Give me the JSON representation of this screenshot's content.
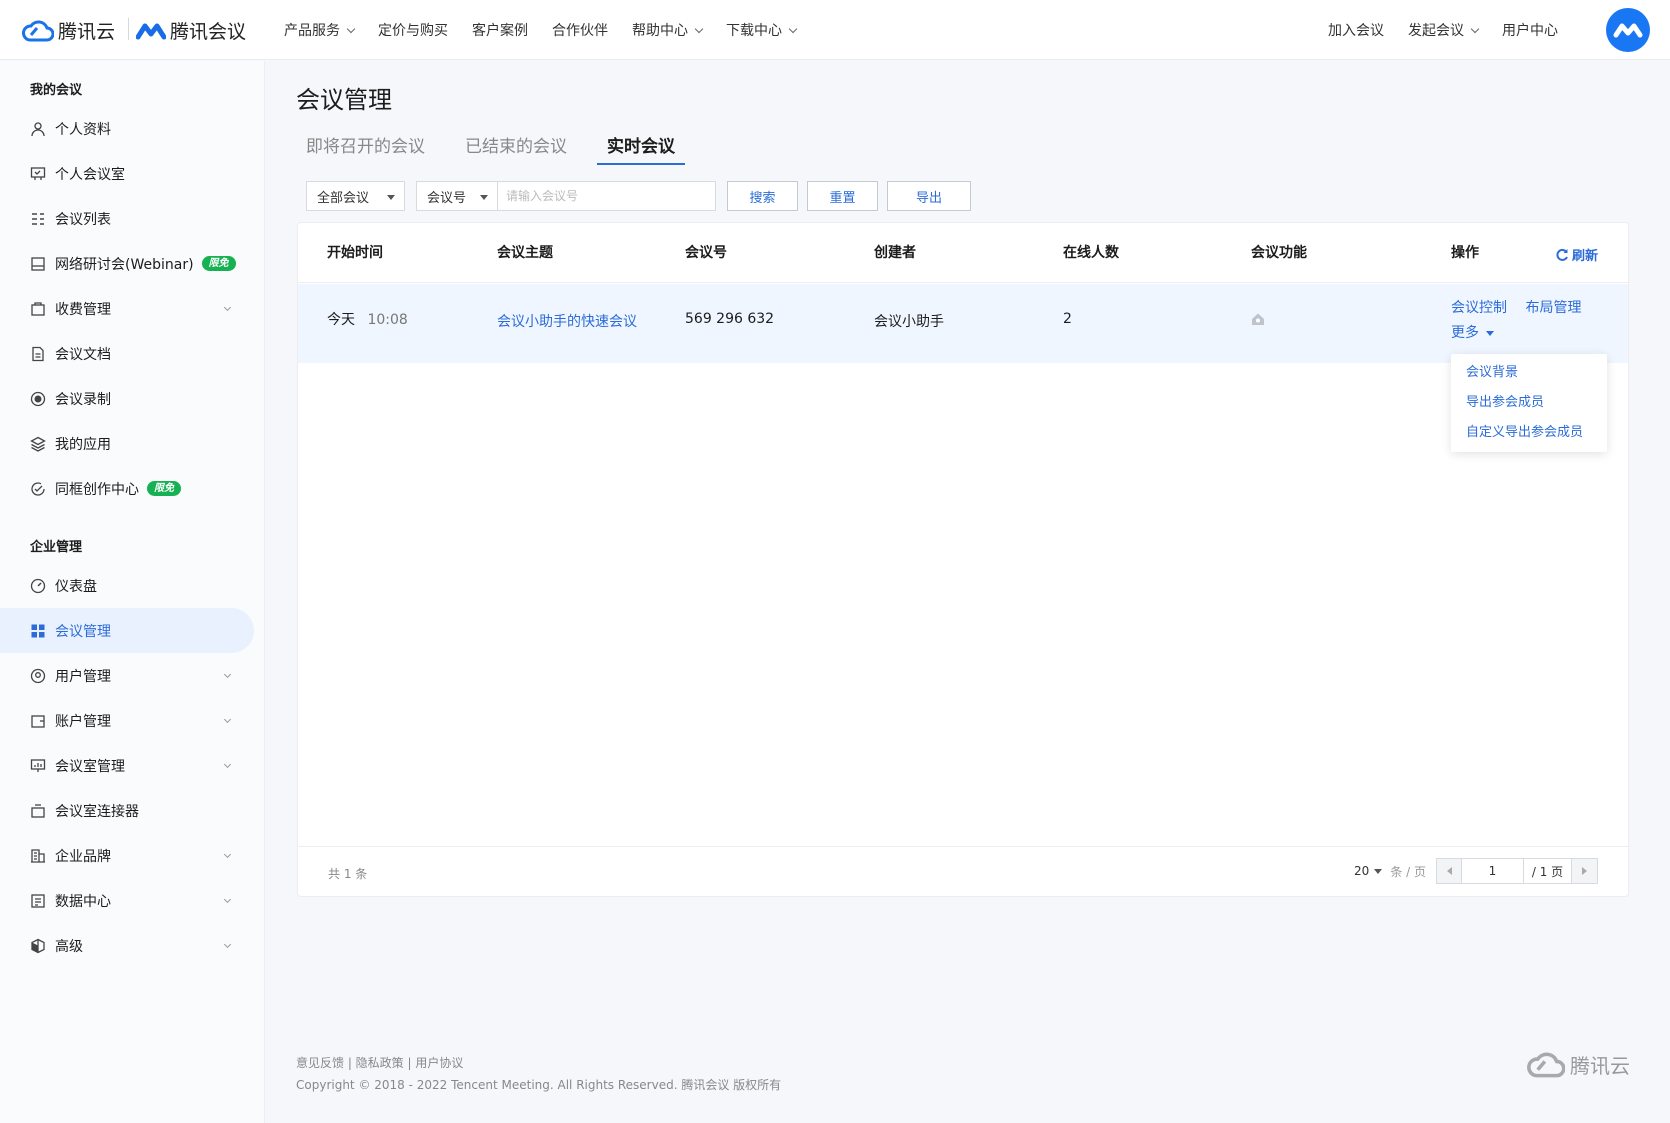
{
  "brand": {
    "tencent_cloud": "腾讯云",
    "meeting": "腾讯会议"
  },
  "nav": {
    "items": [
      {
        "label": "产品服务",
        "dropdown": true
      },
      {
        "label": "定价与购买",
        "dropdown": false
      },
      {
        "label": "客户案例",
        "dropdown": false
      },
      {
        "label": "合作伙伴",
        "dropdown": false
      },
      {
        "label": "帮助中心",
        "dropdown": true
      },
      {
        "label": "下载中心",
        "dropdown": true
      }
    ],
    "right": {
      "join": "加入会议",
      "start": "发起会议",
      "user_center": "用户中心"
    }
  },
  "sidebar": {
    "group1": "我的会议",
    "group1_items": [
      {
        "label": "个人资料",
        "icon": "user-icon"
      },
      {
        "label": "个人会议室",
        "icon": "meeting-room-icon"
      },
      {
        "label": "会议列表",
        "icon": "list-icon"
      },
      {
        "label": "网络研讨会(Webinar)",
        "icon": "webinar-icon",
        "badge": "限免"
      },
      {
        "label": "收费管理",
        "icon": "billing-icon",
        "arrow": true
      },
      {
        "label": "会议文档",
        "icon": "document-icon"
      },
      {
        "label": "会议录制",
        "icon": "record-icon"
      },
      {
        "label": "我的应用",
        "icon": "apps-icon"
      },
      {
        "label": "同框创作中心",
        "icon": "creation-icon",
        "badge": "限免"
      }
    ],
    "group2": "企业管理",
    "group2_items": [
      {
        "label": "仪表盘",
        "icon": "dashboard-icon"
      },
      {
        "label": "会议管理",
        "icon": "grid-icon",
        "active": true
      },
      {
        "label": "用户管理",
        "icon": "users-icon",
        "arrow": true
      },
      {
        "label": "账户管理",
        "icon": "wallet-icon",
        "arrow": true
      },
      {
        "label": "会议室管理",
        "icon": "room-manage-icon",
        "arrow": true
      },
      {
        "label": "会议室连接器",
        "icon": "connector-icon"
      },
      {
        "label": "企业品牌",
        "icon": "brand-icon",
        "arrow": true
      },
      {
        "label": "数据中心",
        "icon": "data-icon",
        "arrow": true
      },
      {
        "label": "高级",
        "icon": "advanced-icon",
        "arrow": true
      }
    ]
  },
  "page": {
    "title": "会议管理",
    "tabs": [
      {
        "label": "即将召开的会议"
      },
      {
        "label": "已结束的会议"
      },
      {
        "label": "实时会议",
        "active": true
      }
    ]
  },
  "filters": {
    "scope": "全部会议",
    "field": "会议号",
    "search_placeholder": "请输入会议号",
    "search_button": "搜索",
    "reset_button": "重置",
    "export_button": "导出"
  },
  "table": {
    "columns": [
      "开始时间",
      "会议主题",
      "会议号",
      "创建者",
      "在线人数",
      "会议功能",
      "操作"
    ],
    "refresh": "刷新",
    "rows": [
      {
        "date": "今天",
        "time": "10:08",
        "subject": "会议小助手的快速会议",
        "meeting_id": "569 296 632",
        "creator": "会议小助手",
        "online": "2",
        "actions": {
          "control": "会议控制",
          "layout": "布局管理",
          "more": "更多"
        }
      }
    ],
    "more_menu": [
      "会议背景",
      "导出参会成员",
      "自定义导出参会成员"
    ],
    "footer": {
      "total": "共 1 条",
      "page_size": "20",
      "per_page": "条 / 页",
      "current_page": "1",
      "total_pages": "/ 1 页"
    }
  },
  "footer": {
    "links": "意见反馈 | 隐私政策 | 用户协议",
    "copyright": "Copyright © 2018 - 2022 Tencent Meeting. All Rights Reserved. 腾讯会议 版权所有",
    "logo": "腾讯云"
  },
  "colors": {
    "accent": "#2b6cd8",
    "active_bg": "#e9f1fe",
    "badge": "#16b153",
    "row_highlight": "#f0f6ff"
  }
}
